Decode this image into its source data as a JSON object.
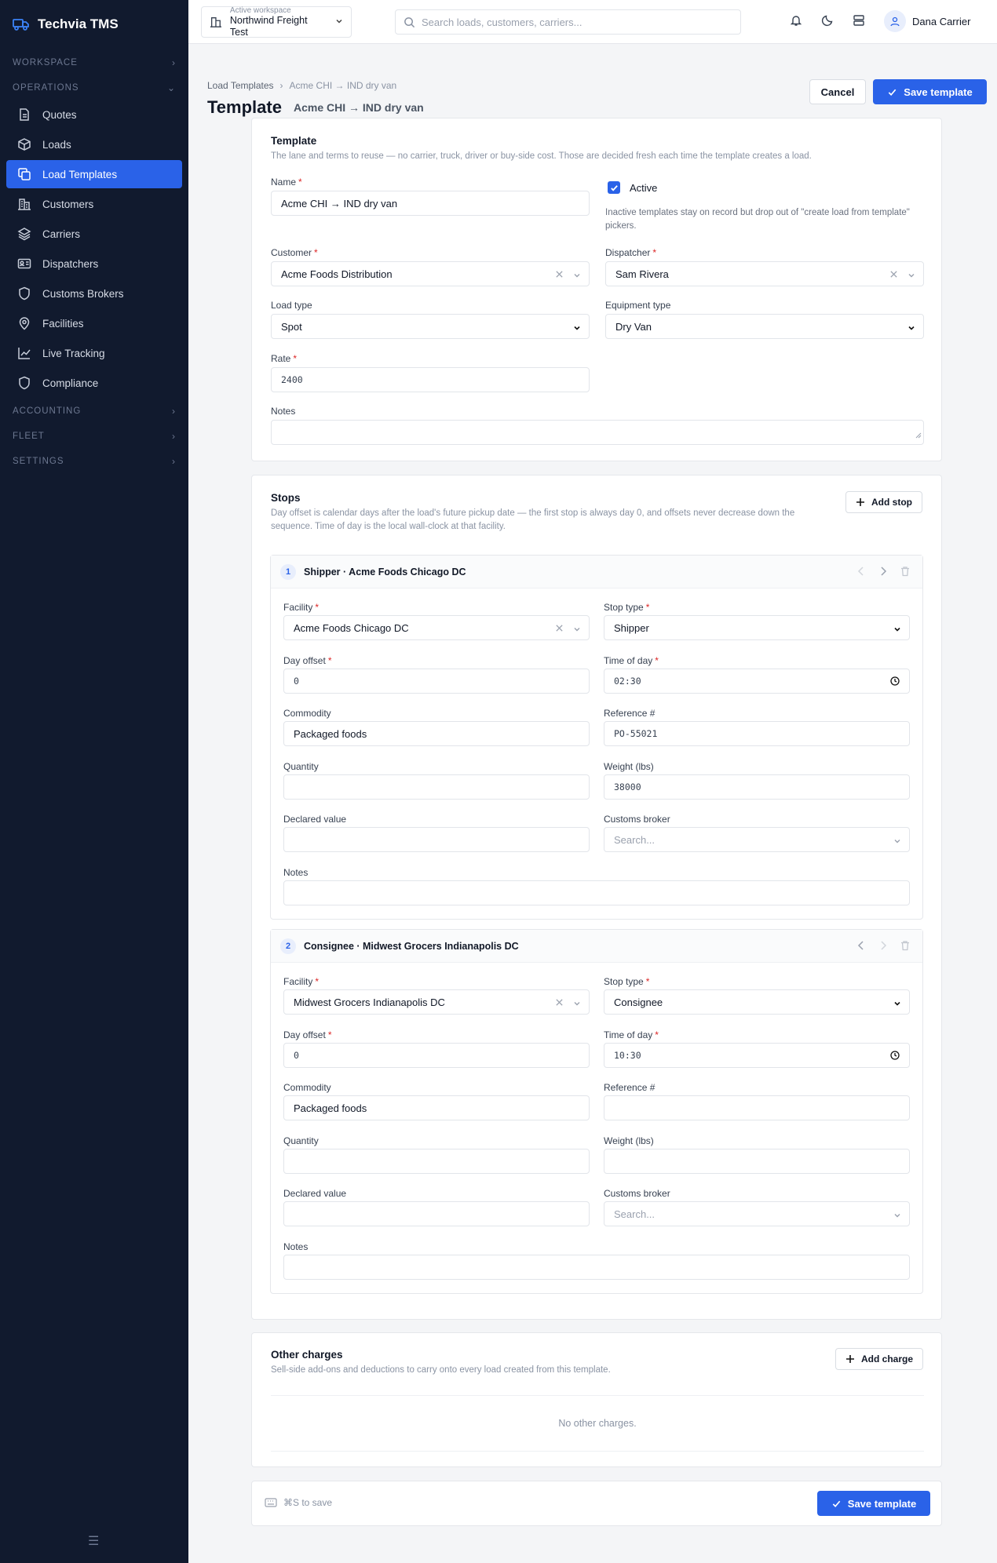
{
  "app": {
    "name": "Techvia TMS"
  },
  "sidebar": {
    "sections": {
      "workspace": "WORKSPACE",
      "operations": "OPERATIONS",
      "accounting": "ACCOUNTING",
      "fleet": "FLEET",
      "settings": "SETTINGS"
    },
    "items": [
      {
        "label": "Quotes",
        "icon": "document-icon"
      },
      {
        "label": "Loads",
        "icon": "box-icon"
      },
      {
        "label": "Load Templates",
        "icon": "copy-icon",
        "active": true
      },
      {
        "label": "Customers",
        "icon": "building-icon"
      },
      {
        "label": "Carriers",
        "icon": "layers-icon"
      },
      {
        "label": "Dispatchers",
        "icon": "id-card-icon"
      },
      {
        "label": "Customs Brokers",
        "icon": "shield-icon"
      },
      {
        "label": "Facilities",
        "icon": "map-pin-icon"
      },
      {
        "label": "Live Tracking",
        "icon": "chart-line-icon"
      },
      {
        "label": "Compliance",
        "icon": "shield-icon"
      }
    ]
  },
  "topbar": {
    "workspace_label": "Active workspace",
    "workspace_value": "Northwind Freight Test",
    "search_placeholder": "Search loads, customers, carriers...",
    "user_name": "Dana Carrier"
  },
  "header": {
    "breadcrumb": [
      "Load Templates",
      "Acme CHI → IND dry van"
    ],
    "title": "Template",
    "subtitle": "Acme CHI → IND dry van",
    "cancel_label": "Cancel",
    "save_label": "Save template"
  },
  "template_card": {
    "title": "Template",
    "description": "The lane and terms to reuse — no carrier, truck, driver or buy-side cost. Those are decided fresh each time the template creates a load.",
    "name_label": "Name",
    "name_value": "Acme CHI → IND dry van",
    "active_label": "Active",
    "active_help": "Inactive templates stay on record but drop out of \"create load from template\" pickers.",
    "customer_label": "Customer",
    "customer_value": "Acme Foods Distribution",
    "dispatcher_label": "Dispatcher",
    "dispatcher_value": "Sam Rivera",
    "load_type_label": "Load type",
    "load_type_value": "Spot",
    "equipment_label": "Equipment type",
    "equipment_value": "Dry Van",
    "rate_label": "Rate",
    "rate_value": "2400",
    "notes_label": "Notes"
  },
  "stops_card": {
    "title": "Stops",
    "description": "Day offset is calendar days after the load's future pickup date — the first stop is always day 0, and offsets never decrease down the sequence. Time of day is the local wall-clock at that facility.",
    "add_label": "Add stop",
    "field_labels": {
      "facility": "Facility",
      "stop_type": "Stop type",
      "day_offset": "Day offset",
      "time_of_day": "Time of day",
      "commodity": "Commodity",
      "reference": "Reference #",
      "quantity": "Quantity",
      "weight": "Weight (lbs)",
      "declared_value": "Declared value",
      "customs_broker": "Customs broker",
      "notes": "Notes"
    },
    "customs_placeholder": "Search...",
    "stops": [
      {
        "number": "1",
        "title": "Shipper · Acme Foods Chicago DC",
        "facility": "Acme Foods Chicago DC",
        "stop_type": "Shipper",
        "day_offset": "0",
        "time_of_day": "02:30",
        "commodity": "Packaged foods",
        "reference": "PO-55021",
        "quantity": "",
        "weight": "38000",
        "declared_value": ""
      },
      {
        "number": "2",
        "title": "Consignee · Midwest Grocers Indianapolis DC",
        "facility": "Midwest Grocers Indianapolis DC",
        "stop_type": "Consignee",
        "day_offset": "0",
        "time_of_day": "10:30",
        "commodity": "Packaged foods",
        "reference": "",
        "quantity": "",
        "weight": "",
        "declared_value": ""
      }
    ]
  },
  "charges_card": {
    "title": "Other charges",
    "description": "Sell-side add-ons and deductions to carry onto every load created from this template.",
    "add_label": "Add charge",
    "empty_text": "No other charges."
  },
  "footer": {
    "shortcut_hint": "⌘S to save",
    "save_label": "Save template"
  },
  "colors": {
    "accent": "#2a62e8",
    "sidebar_bg": "#111a2e",
    "required": "#dc2626"
  }
}
